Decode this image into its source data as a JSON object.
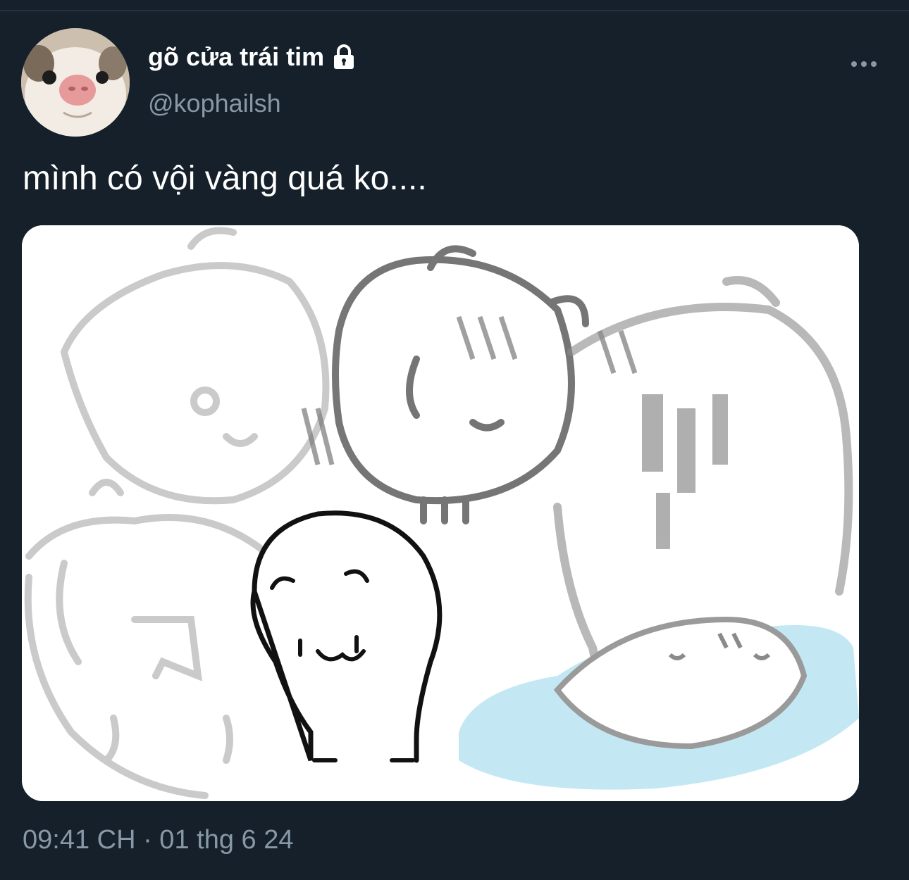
{
  "tweet": {
    "author": {
      "display_name": "gõ cửa trái tim",
      "handle": "@kophailsh",
      "protected_icon": "lock-icon",
      "avatar": "avatar-photo"
    },
    "more_icon": "more-horizontal-icon",
    "text": "mình có vội vàng quá ko....",
    "media": {
      "type": "image",
      "description_icon": "illustration-image"
    },
    "timestamp": "09:41 CH · 01 thg 6 24"
  },
  "colors": {
    "background": "#15202b",
    "text_primary": "#ffffff",
    "text_secondary": "#8899a6",
    "divider": "#253341"
  }
}
